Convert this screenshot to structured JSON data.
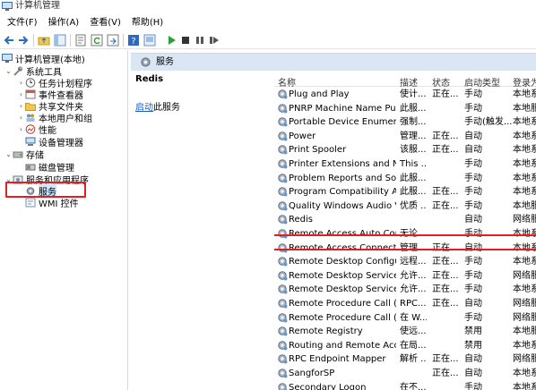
{
  "window": {
    "title": "计算机管理"
  },
  "menu": [
    "文件(F)",
    "操作(A)",
    "查看(V)",
    "帮助(H)"
  ],
  "toolbar_icons": [
    "back-icon",
    "forward-icon",
    "up-folder-icon",
    "show-tree-icon",
    "properties-icon",
    "refresh-icon",
    "export-icon",
    "help-icon",
    "console-icon",
    "start-service-icon",
    "stop-service-icon",
    "pause-service-icon",
    "restart-service-icon"
  ],
  "tree": {
    "root": "计算机管理(本地)",
    "system_tools": "系统工具",
    "task_scheduler": "任务计划程序",
    "event_viewer": "事件查看器",
    "shared_folders": "共享文件夹",
    "local_users": "本地用户和组",
    "performance": "性能",
    "device_manager": "设备管理器",
    "storage": "存储",
    "disk_management": "磁盘管理",
    "services_apps": "服务和应用程序",
    "services": "服务",
    "wmi": "WMI 控件"
  },
  "header": {
    "title": "服务"
  },
  "detail": {
    "service_name": "Redis",
    "action_link": "启动",
    "action_suffix": "此服务"
  },
  "columns": {
    "name": "名称",
    "desc": "描述",
    "status": "状态",
    "startup": "启动类型",
    "logon": "登录为"
  },
  "services": [
    {
      "name": "Plug and Play",
      "desc": "使计...",
      "status": "正在...",
      "startup": "手动",
      "logon": "本地系"
    },
    {
      "name": "PNRP Machine Name Publ...",
      "desc": "此服...",
      "status": "",
      "startup": "手动",
      "logon": "本地服"
    },
    {
      "name": "Portable Device Enumerat...",
      "desc": "强制...",
      "status": "",
      "startup": "手动(触发...",
      "logon": "本地系"
    },
    {
      "name": "Power",
      "desc": "管理...",
      "status": "正在...",
      "startup": "自动",
      "logon": "本地系"
    },
    {
      "name": "Print Spooler",
      "desc": "该服...",
      "status": "正在...",
      "startup": "自动",
      "logon": "本地系"
    },
    {
      "name": "Printer Extensions and Noti...",
      "desc": "This ...",
      "status": "",
      "startup": "手动",
      "logon": "本地系"
    },
    {
      "name": "Problem Reports and Solut...",
      "desc": "此服...",
      "status": "",
      "startup": "手动",
      "logon": "本地系"
    },
    {
      "name": "Program Compatibility Assi...",
      "desc": "此服...",
      "status": "正在...",
      "startup": "手动",
      "logon": "本地系"
    },
    {
      "name": "Quality Windows Audio Vi...",
      "desc": "优质 ...",
      "status": "正在...",
      "startup": "手动",
      "logon": "本地服"
    },
    {
      "name": "Redis",
      "desc": "",
      "status": "",
      "startup": "自动",
      "logon": "网络服"
    },
    {
      "name": "Remote Access Auto Conn...",
      "desc": "无论...",
      "status": "",
      "startup": "手动",
      "logon": "本地系"
    },
    {
      "name": "Remote Access Connectio...",
      "desc": "管理...",
      "status": "正在...",
      "startup": "自动",
      "logon": "本地系"
    },
    {
      "name": "Remote Desktop Configur...",
      "desc": "远程...",
      "status": "正在...",
      "startup": "手动",
      "logon": "本地系"
    },
    {
      "name": "Remote Desktop Services",
      "desc": "允许...",
      "status": "正在...",
      "startup": "手动",
      "logon": "网络服"
    },
    {
      "name": "Remote Desktop Services ...",
      "desc": "允许...",
      "status": "正在...",
      "startup": "手动",
      "logon": "本地系"
    },
    {
      "name": "Remote Procedure Call (R...",
      "desc": "RPC...",
      "status": "正在...",
      "startup": "自动",
      "logon": "网络服"
    },
    {
      "name": "Remote Procedure Call (R...",
      "desc": "在 W...",
      "status": "",
      "startup": "手动",
      "logon": "网络服"
    },
    {
      "name": "Remote Registry",
      "desc": "使远...",
      "status": "",
      "startup": "禁用",
      "logon": "本地服"
    },
    {
      "name": "Routing and Remote Access",
      "desc": "在局...",
      "status": "",
      "startup": "禁用",
      "logon": "本地系"
    },
    {
      "name": "RPC Endpoint Mapper",
      "desc": "解析 ...",
      "status": "正在...",
      "startup": "自动",
      "logon": "网络服"
    },
    {
      "name": "SangforSP",
      "desc": "",
      "status": "正在...",
      "startup": "自动",
      "logon": "本地系"
    },
    {
      "name": "Secondary Logon",
      "desc": "在不...",
      "status": "",
      "startup": "手动",
      "logon": "本地系"
    }
  ]
}
